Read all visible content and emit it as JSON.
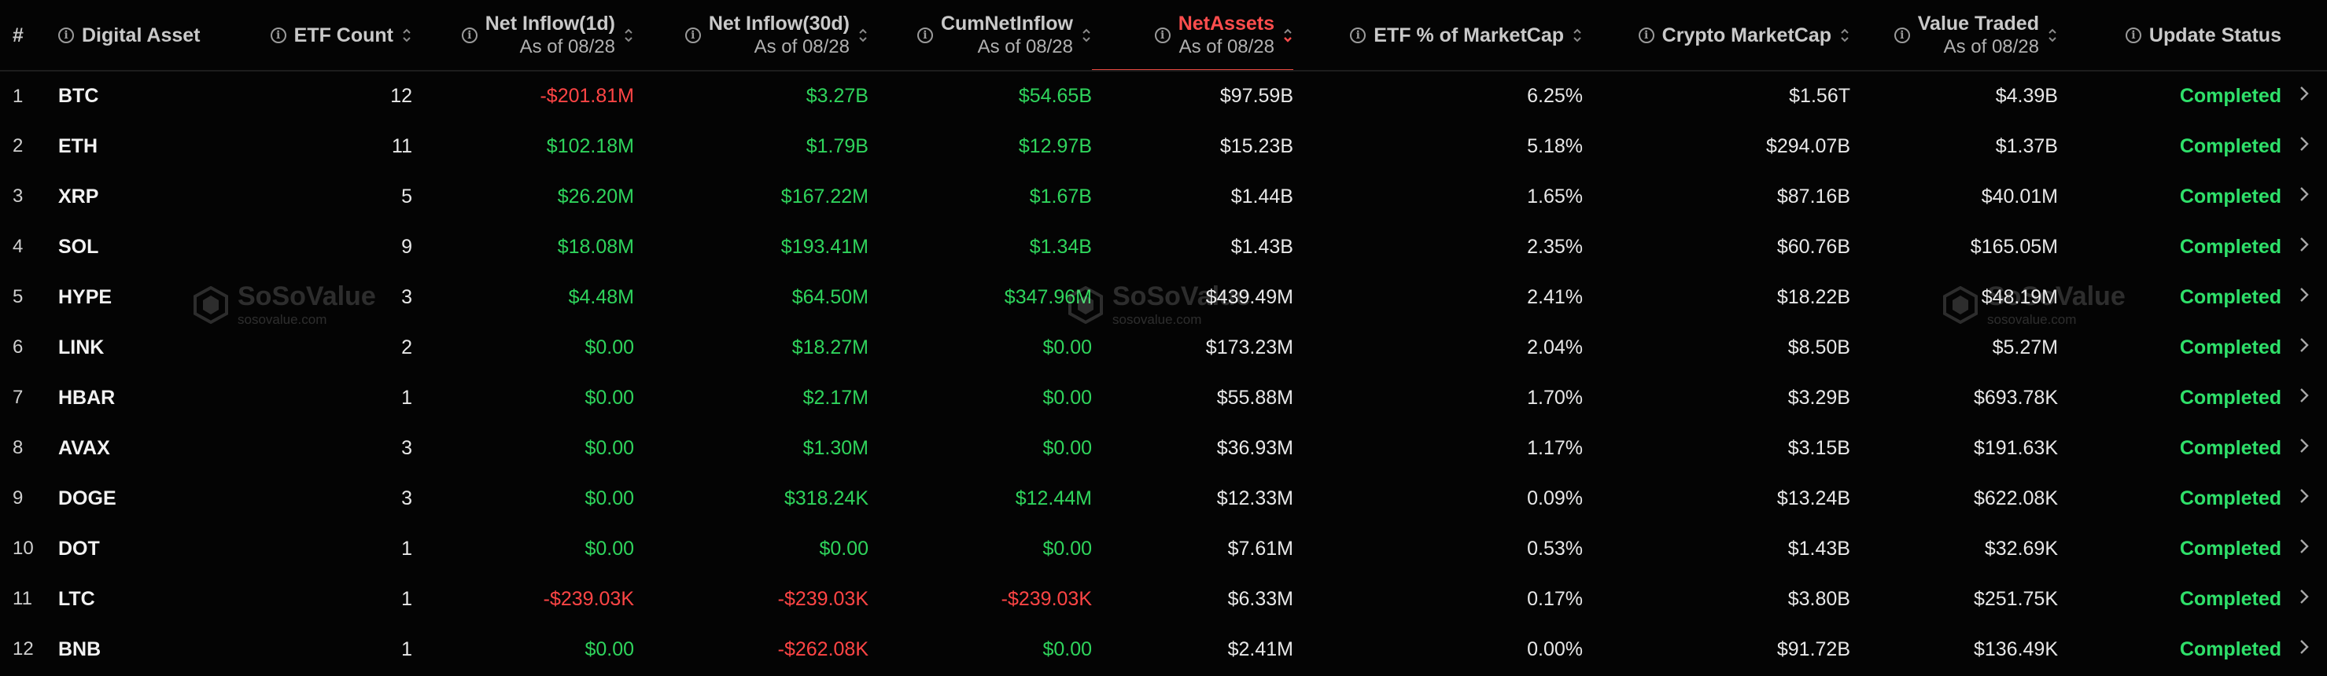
{
  "watermark": {
    "brand": "SoSoValue",
    "domain": "sosovalue.com"
  },
  "columns": {
    "index": {
      "label": "#"
    },
    "asset": {
      "label": "Digital Asset",
      "icon": "info-icon"
    },
    "etf_count": {
      "label": "ETF Count",
      "icon": "info-icon",
      "sort": "sort-icon"
    },
    "net_inflow_1d": {
      "label": "Net Inflow(1d)",
      "sub": "As of 08/28",
      "icon": "info-icon",
      "sort": "sort-icon"
    },
    "net_inflow_30d": {
      "label": "Net Inflow(30d)",
      "sub": "As of 08/28",
      "icon": "info-icon",
      "sort": "sort-icon"
    },
    "cum_net_inflow": {
      "label": "CumNetInflow",
      "sub": "As of 08/28",
      "icon": "info-icon",
      "sort": "sort-icon"
    },
    "net_assets": {
      "label": "NetAssets",
      "sub": "As of 08/28",
      "icon": "info-icon",
      "sort": "sort-icon",
      "active": true
    },
    "etf_pct_mcap": {
      "label": "ETF % of MarketCap",
      "icon": "info-icon",
      "sort": "sort-icon"
    },
    "crypto_mcap": {
      "label": "Crypto MarketCap",
      "icon": "info-icon",
      "sort": "sort-icon"
    },
    "value_traded": {
      "label": "Value Traded",
      "sub": "As of 08/28",
      "icon": "info-icon",
      "sort": "sort-icon"
    },
    "update_status": {
      "label": "Update Status",
      "icon": "info-icon"
    }
  },
  "colors": {
    "positive": "#2fd45c",
    "negative": "#ff4545",
    "active_header": "#ff4d4d",
    "status": "#2fe06a"
  },
  "rows": [
    {
      "index": "1",
      "asset": "BTC",
      "etf_count": "12",
      "net_inflow_1d": "-$201.81M",
      "net_inflow_30d": "$3.27B",
      "cum_net_inflow": "$54.65B",
      "net_assets": "$97.59B",
      "etf_pct_mcap": "6.25%",
      "crypto_mcap": "$1.56T",
      "value_traded": "$4.39B",
      "status": "Completed"
    },
    {
      "index": "2",
      "asset": "ETH",
      "etf_count": "11",
      "net_inflow_1d": "$102.18M",
      "net_inflow_30d": "$1.79B",
      "cum_net_inflow": "$12.97B",
      "net_assets": "$15.23B",
      "etf_pct_mcap": "5.18%",
      "crypto_mcap": "$294.07B",
      "value_traded": "$1.37B",
      "status": "Completed"
    },
    {
      "index": "3",
      "asset": "XRP",
      "etf_count": "5",
      "net_inflow_1d": "$26.20M",
      "net_inflow_30d": "$167.22M",
      "cum_net_inflow": "$1.67B",
      "net_assets": "$1.44B",
      "etf_pct_mcap": "1.65%",
      "crypto_mcap": "$87.16B",
      "value_traded": "$40.01M",
      "status": "Completed"
    },
    {
      "index": "4",
      "asset": "SOL",
      "etf_count": "9",
      "net_inflow_1d": "$18.08M",
      "net_inflow_30d": "$193.41M",
      "cum_net_inflow": "$1.34B",
      "net_assets": "$1.43B",
      "etf_pct_mcap": "2.35%",
      "crypto_mcap": "$60.76B",
      "value_traded": "$165.05M",
      "status": "Completed"
    },
    {
      "index": "5",
      "asset": "HYPE",
      "etf_count": "3",
      "net_inflow_1d": "$4.48M",
      "net_inflow_30d": "$64.50M",
      "cum_net_inflow": "$347.96M",
      "net_assets": "$439.49M",
      "etf_pct_mcap": "2.41%",
      "crypto_mcap": "$18.22B",
      "value_traded": "$48.19M",
      "status": "Completed"
    },
    {
      "index": "6",
      "asset": "LINK",
      "etf_count": "2",
      "net_inflow_1d": "$0.00",
      "net_inflow_30d": "$18.27M",
      "cum_net_inflow": "$0.00",
      "net_assets": "$173.23M",
      "etf_pct_mcap": "2.04%",
      "crypto_mcap": "$8.50B",
      "value_traded": "$5.27M",
      "status": "Completed"
    },
    {
      "index": "7",
      "asset": "HBAR",
      "etf_count": "1",
      "net_inflow_1d": "$0.00",
      "net_inflow_30d": "$2.17M",
      "cum_net_inflow": "$0.00",
      "net_assets": "$55.88M",
      "etf_pct_mcap": "1.70%",
      "crypto_mcap": "$3.29B",
      "value_traded": "$693.78K",
      "status": "Completed"
    },
    {
      "index": "8",
      "asset": "AVAX",
      "etf_count": "3",
      "net_inflow_1d": "$0.00",
      "net_inflow_30d": "$1.30M",
      "cum_net_inflow": "$0.00",
      "net_assets": "$36.93M",
      "etf_pct_mcap": "1.17%",
      "crypto_mcap": "$3.15B",
      "value_traded": "$191.63K",
      "status": "Completed"
    },
    {
      "index": "9",
      "asset": "DOGE",
      "etf_count": "3",
      "net_inflow_1d": "$0.00",
      "net_inflow_30d": "$318.24K",
      "cum_net_inflow": "$12.44M",
      "net_assets": "$12.33M",
      "etf_pct_mcap": "0.09%",
      "crypto_mcap": "$13.24B",
      "value_traded": "$622.08K",
      "status": "Completed"
    },
    {
      "index": "10",
      "asset": "DOT",
      "etf_count": "1",
      "net_inflow_1d": "$0.00",
      "net_inflow_30d": "$0.00",
      "cum_net_inflow": "$0.00",
      "net_assets": "$7.61M",
      "etf_pct_mcap": "0.53%",
      "crypto_mcap": "$1.43B",
      "value_traded": "$32.69K",
      "status": "Completed"
    },
    {
      "index": "11",
      "asset": "LTC",
      "etf_count": "1",
      "net_inflow_1d": "-$239.03K",
      "net_inflow_30d": "-$239.03K",
      "cum_net_inflow": "-$239.03K",
      "net_assets": "$6.33M",
      "etf_pct_mcap": "0.17%",
      "crypto_mcap": "$3.80B",
      "value_traded": "$251.75K",
      "status": "Completed"
    },
    {
      "index": "12",
      "asset": "BNB",
      "etf_count": "1",
      "net_inflow_1d": "$0.00",
      "net_inflow_30d": "-$262.08K",
      "cum_net_inflow": "$0.00",
      "net_assets": "$2.41M",
      "etf_pct_mcap": "0.00%",
      "crypto_mcap": "$91.72B",
      "value_traded": "$136.49K",
      "status": "Completed"
    }
  ]
}
